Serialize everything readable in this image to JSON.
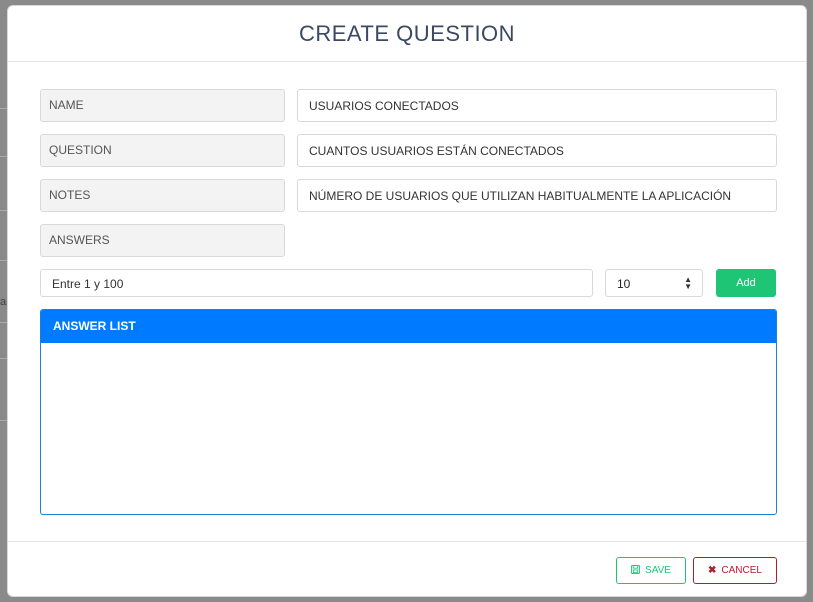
{
  "backdrop": {
    "partial_text": "ar"
  },
  "modal": {
    "title": "CREATE QUESTION",
    "fields": [
      {
        "label": "NAME",
        "value": "USUARIOS CONECTADOS"
      },
      {
        "label": "QUESTION",
        "value": "CUANTOS USUARIOS ESTÁN CONECTADOS"
      },
      {
        "label": "NOTES",
        "value": "NÚMERO DE USUARIOS QUE UTILIZAN HABITUALMENTE LA APLICACIÓN"
      },
      {
        "label": "ANSWERS"
      }
    ],
    "answer_input": {
      "value": "Entre 1 y 100"
    },
    "number_input": {
      "value": "10"
    },
    "add_label": "Add",
    "answer_list": {
      "header": "ANSWER LIST",
      "items": []
    },
    "footer": {
      "save_label": "SAVE",
      "cancel_label": "CANCEL"
    }
  },
  "colors": {
    "accent_blue": "#007bff",
    "success_green": "#1ec574",
    "danger_red": "#b71c2c",
    "title": "#3a4a63"
  },
  "icons": {
    "save": "floppy-disk-icon",
    "cancel": "x-icon",
    "spinner": "up-down-spinner-icon"
  }
}
